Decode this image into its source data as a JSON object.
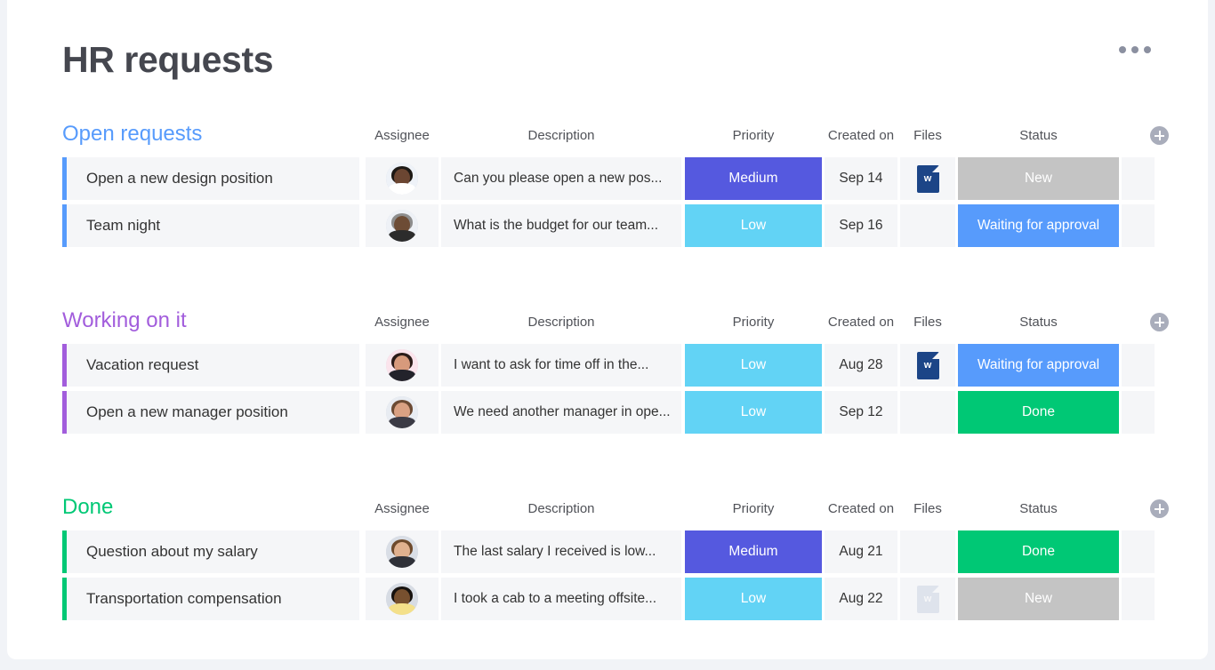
{
  "board": {
    "title": "HR requests",
    "menu_icon": "more-horizontal-icon",
    "add_column_icon": "plus-circle-icon"
  },
  "columns": [
    {
      "key": "assignee",
      "label": "Assignee"
    },
    {
      "key": "description",
      "label": "Description"
    },
    {
      "key": "priority",
      "label": "Priority"
    },
    {
      "key": "created_on",
      "label": "Created on"
    },
    {
      "key": "files",
      "label": "Files"
    },
    {
      "key": "status",
      "label": "Status"
    }
  ],
  "colors": {
    "group_open": "#579bfc",
    "group_working": "#a25ddc",
    "group_done": "#00c875",
    "priority_medium": "#5559df",
    "priority_low": "#62d3f5",
    "status_new": "#c4c4c4",
    "status_waiting": "#579bfc",
    "status_done": "#00c875",
    "cell_bg": "#f5f6f8",
    "title_text": "#45474f"
  },
  "groups": [
    {
      "name": "Open requests",
      "color": "#579bfc",
      "rows": [
        {
          "name": "Open a new design position",
          "assignee_icon": "avatar",
          "description": "Can you please open a new pos...",
          "priority": {
            "label": "Medium",
            "color": "#5559df"
          },
          "created_on": "Sep 14",
          "file": {
            "icon": "word-file-icon",
            "label": "w",
            "visible": true,
            "faint": false
          },
          "status": {
            "label": "New",
            "color": "#c4c4c4"
          }
        },
        {
          "name": "Team night",
          "assignee_icon": "avatar",
          "description": "What is the budget for our team...",
          "priority": {
            "label": "Low",
            "color": "#62d3f5"
          },
          "created_on": "Sep 16",
          "file": {
            "icon": "word-file-icon",
            "label": "w",
            "visible": false,
            "faint": false
          },
          "status": {
            "label": "Waiting for approval",
            "color": "#579bfc"
          }
        }
      ]
    },
    {
      "name": "Working on it",
      "color": "#a25ddc",
      "rows": [
        {
          "name": "Vacation request",
          "assignee_icon": "avatar",
          "description": "I want to ask for time off in the...",
          "priority": {
            "label": "Low",
            "color": "#62d3f5"
          },
          "created_on": "Aug 28",
          "file": {
            "icon": "word-file-icon",
            "label": "w",
            "visible": true,
            "faint": false
          },
          "status": {
            "label": "Waiting for approval",
            "color": "#579bfc"
          }
        },
        {
          "name": "Open a new manager position",
          "assignee_icon": "avatar",
          "description": "We need another manager in ope...",
          "priority": {
            "label": "Low",
            "color": "#62d3f5"
          },
          "created_on": "Sep 12",
          "file": {
            "icon": "word-file-icon",
            "label": "w",
            "visible": false,
            "faint": false
          },
          "status": {
            "label": "Done",
            "color": "#00c875"
          }
        }
      ]
    },
    {
      "name": "Done",
      "color": "#00c875",
      "rows": [
        {
          "name": "Question about my salary",
          "assignee_icon": "avatar",
          "description": "The last salary I received is low...",
          "priority": {
            "label": "Medium",
            "color": "#5559df"
          },
          "created_on": "Aug 21",
          "file": {
            "icon": "word-file-icon",
            "label": "w",
            "visible": false,
            "faint": false
          },
          "status": {
            "label": "Done",
            "color": "#00c875"
          }
        },
        {
          "name": "Transportation compensation",
          "assignee_icon": "avatar",
          "description": "I took a cab to a meeting offsite...",
          "priority": {
            "label": "Low",
            "color": "#62d3f5"
          },
          "created_on": "Aug 22",
          "file": {
            "icon": "word-file-icon",
            "label": "w",
            "visible": true,
            "faint": true
          },
          "status": {
            "label": "New",
            "color": "#c4c4c4"
          }
        }
      ]
    }
  ]
}
